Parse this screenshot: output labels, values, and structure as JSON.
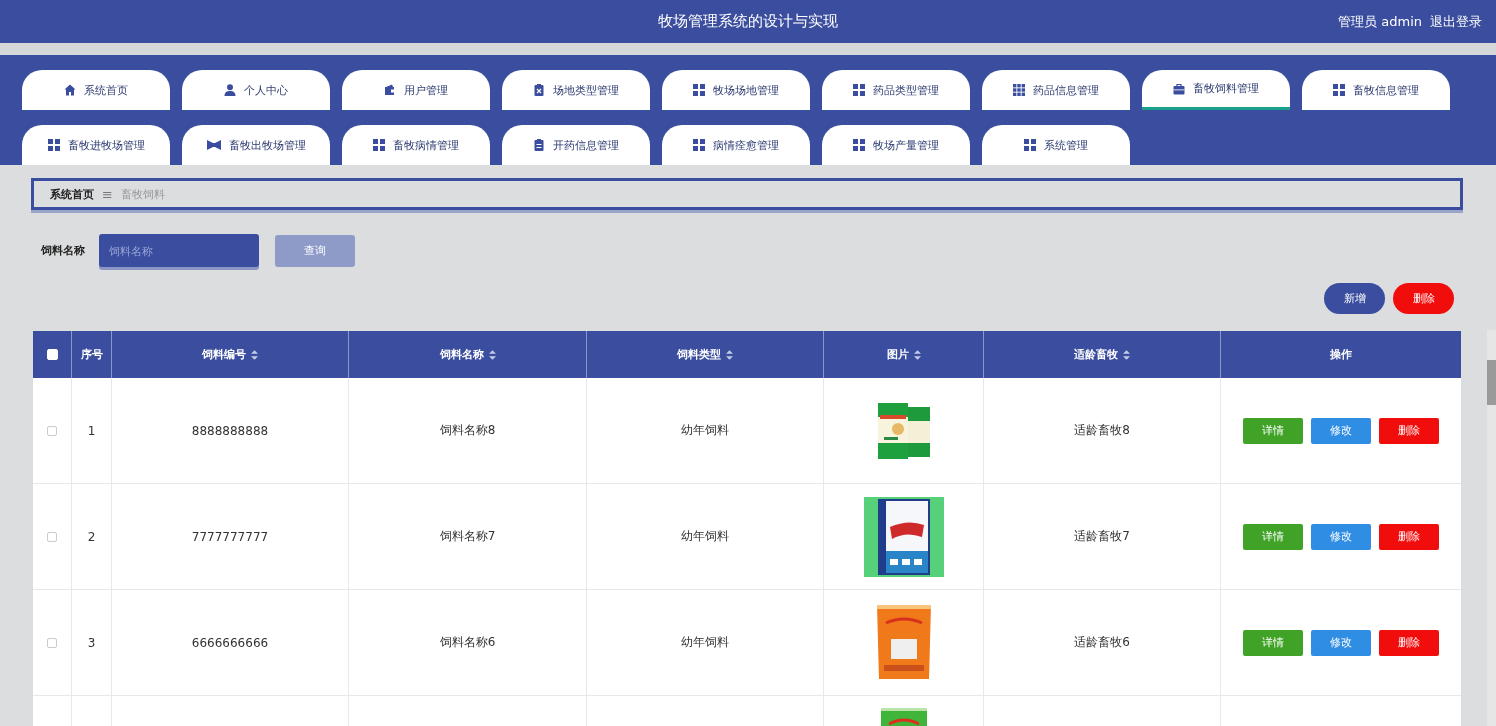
{
  "header": {
    "title": "牧场管理系统的设计与实现",
    "user": "管理员 admin",
    "logout": "退出登录"
  },
  "tabs": [
    {
      "label": "系统首页",
      "selected": false
    },
    {
      "label": "个人中心",
      "selected": false
    },
    {
      "label": "用户管理",
      "selected": false
    },
    {
      "label": "场地类型管理",
      "selected": false
    },
    {
      "label": "牧场场地管理",
      "selected": false
    },
    {
      "label": "药品类型管理",
      "selected": false
    },
    {
      "label": "药品信息管理",
      "selected": false
    },
    {
      "label": "畜牧饲料管理",
      "selected": true
    },
    {
      "label": "畜牧信息管理",
      "selected": false
    },
    {
      "label": "畜牧进牧场管理",
      "selected": false
    },
    {
      "label": "畜牧出牧场管理",
      "selected": false
    },
    {
      "label": "畜牧病情管理",
      "selected": false
    },
    {
      "label": "开药信息管理",
      "selected": false
    },
    {
      "label": "病情痊愈管理",
      "selected": false
    },
    {
      "label": "牧场产量管理",
      "selected": false
    },
    {
      "label": "系统管理",
      "selected": false
    }
  ],
  "breadcrumb": {
    "home": "系统首页",
    "separator": "≡",
    "current": "畜牧饲料"
  },
  "search": {
    "label": "饲料名称",
    "placeholder": "饲料名称",
    "button": "查询"
  },
  "actions": {
    "add": "新增",
    "delete": "删除"
  },
  "table": {
    "select_all_checked": false,
    "columns": [
      {
        "label": "序号",
        "sortable": false
      },
      {
        "label": "饲料编号",
        "sortable": true
      },
      {
        "label": "饲料名称",
        "sortable": true
      },
      {
        "label": "饲料类型",
        "sortable": true
      },
      {
        "label": "图片",
        "sortable": true
      },
      {
        "label": "适龄畜牧",
        "sortable": true
      },
      {
        "label": "操作",
        "sortable": false
      }
    ],
    "rows": [
      {
        "checked": false,
        "index": "1",
        "code": "8888888888",
        "name": "饲料名称8",
        "type": "幼年饲料",
        "image": {
          "kind": "picture"
        },
        "age": "适龄畜牧8",
        "buttons": [
          "详情",
          "修改",
          "删除"
        ]
      },
      {
        "checked": false,
        "index": "2",
        "code": "7777777777",
        "name": "饲料名称7",
        "type": "幼年饲料",
        "image": {
          "kind": "picture"
        },
        "age": "适龄畜牧7",
        "buttons": [
          "详情",
          "修改",
          "删除"
        ]
      },
      {
        "checked": false,
        "index": "3",
        "code": "6666666666",
        "name": "饲料名称6",
        "type": "幼年饲料",
        "image": {
          "kind": "picture"
        },
        "age": "适龄畜牧6",
        "buttons": [
          "详情",
          "修改",
          "删除"
        ]
      },
      {
        "image": {
          "kind": "picture"
        }
      }
    ]
  }
}
